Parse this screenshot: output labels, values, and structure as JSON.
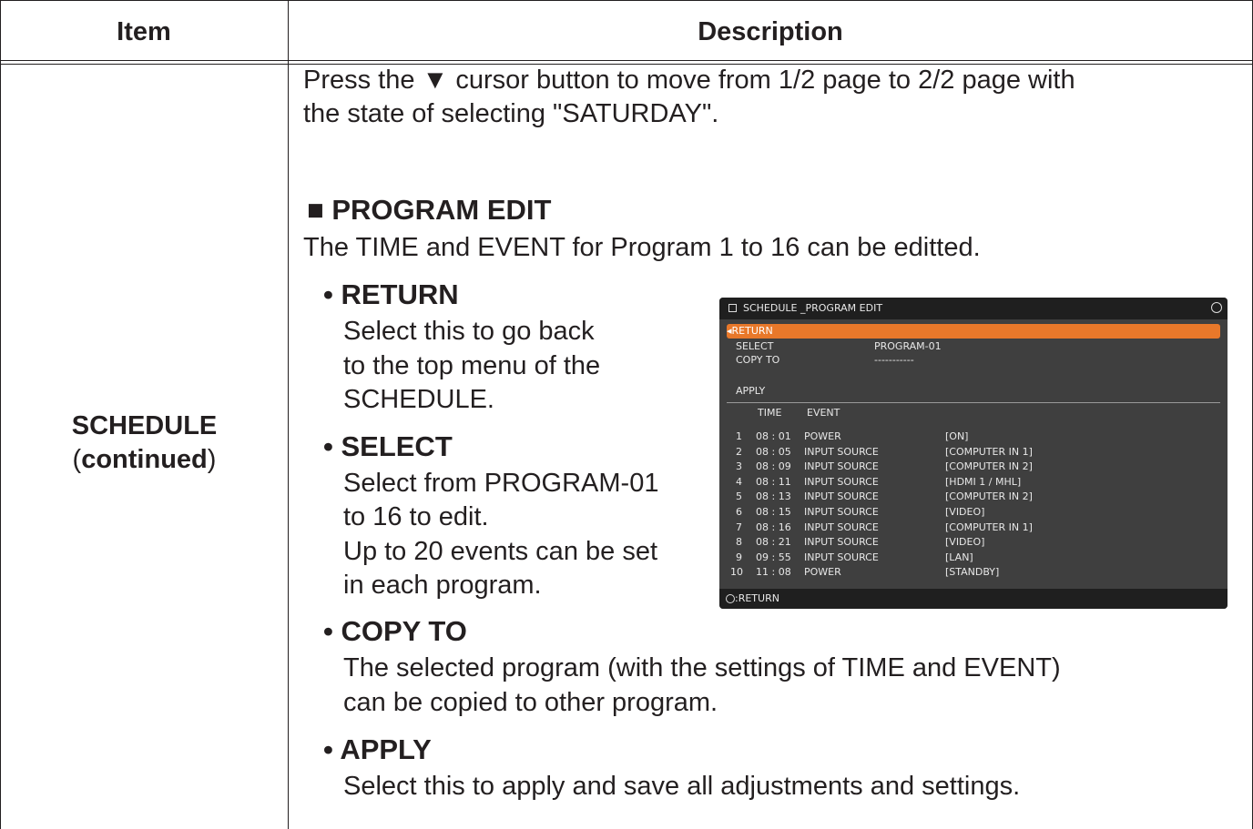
{
  "header": {
    "item": "Item",
    "description": "Description"
  },
  "item": {
    "name": "SCHEDULE",
    "open_paren": "(",
    "continued": "continued",
    "close_paren": ")"
  },
  "intro": {
    "line1": "Press the ▼ cursor button to move from 1/2 page to 2/2 page with",
    "line2": "the state of selecting \"SATURDAY\"."
  },
  "section": {
    "title": "■ PROGRAM EDIT",
    "desc": "The TIME and EVENT for Program 1 to 16 can be editted."
  },
  "return_item": {
    "title": "• RETURN",
    "l1": "Select this to go back",
    "l2": "to the top menu of the",
    "l3": "SCHEDULE."
  },
  "select_item": {
    "title": "• SELECT",
    "l1": "Select from PROGRAM-01",
    "l2": "to 16 to edit.",
    "l3": "Up to 20 events can be set",
    "l4": "in each program."
  },
  "copy_item": {
    "title": "• COPY TO",
    "l1": "The selected program (with the settings of TIME and EVENT)",
    "l2": "can be copied to other program."
  },
  "apply_item": {
    "title": "• APPLY",
    "l1": "Select this to apply and save all adjustments and settings."
  },
  "osd": {
    "title": "SCHEDULE _PROGRAM EDIT",
    "return": "◂RETURN",
    "select_label": "SELECT",
    "select_value": "PROGRAM-01",
    "copy_label": "COPY TO",
    "copy_value": "-----------",
    "apply": "APPLY",
    "col_time": "TIME",
    "col_event": "EVENT",
    "rows": [
      {
        "n": "1",
        "time": "08 : 01",
        "event": "POWER",
        "value": "[ON]"
      },
      {
        "n": "2",
        "time": "08 : 05",
        "event": "INPUT SOURCE",
        "value": "[COMPUTER IN 1]"
      },
      {
        "n": "3",
        "time": "08 : 09",
        "event": "INPUT SOURCE",
        "value": "[COMPUTER IN 2]"
      },
      {
        "n": "4",
        "time": "08 : 11",
        "event": "INPUT SOURCE",
        "value": "[HDMI 1 / MHL]"
      },
      {
        "n": "5",
        "time": "08 : 13",
        "event": "INPUT SOURCE",
        "value": "[COMPUTER IN 2]"
      },
      {
        "n": "6",
        "time": "08 : 15",
        "event": "INPUT SOURCE",
        "value": "[VIDEO]"
      },
      {
        "n": "7",
        "time": "08 : 16",
        "event": "INPUT SOURCE",
        "value": "[COMPUTER IN 1]"
      },
      {
        "n": "8",
        "time": "08 : 21",
        "event": "INPUT SOURCE",
        "value": "[VIDEO]"
      },
      {
        "n": "9",
        "time": "09 : 55",
        "event": "INPUT SOURCE",
        "value": "[LAN]"
      },
      {
        "n": "10",
        "time": "11 : 08",
        "event": "POWER",
        "value": "[STANDBY]"
      }
    ],
    "footer": ":RETURN",
    "accent": "#e8782a"
  }
}
